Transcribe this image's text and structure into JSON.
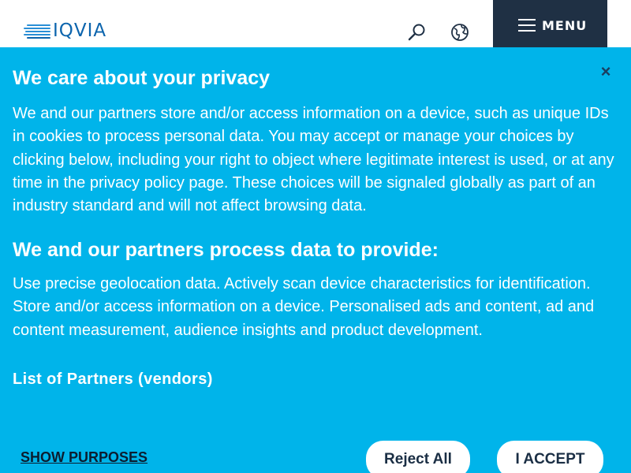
{
  "header": {
    "logo_text": "IQVIA",
    "menu_label": "MENU",
    "icons": {
      "search": "search-icon",
      "globe": "globe-icon",
      "menu": "hamburger-icon"
    }
  },
  "consent": {
    "title": "We care about your privacy",
    "body": "We and our partners store and/or access information on a device, such as unique IDs in cookies to process personal data. You may accept or manage your choices by clicking below, including your right to object where legitimate interest is used, or at any time in the privacy policy page. These choices will be signaled globally as part of an industry standard and will not affect browsing data.",
    "subtitle": "We and our partners process data to provide:",
    "purposes": "Use precise geolocation data. Actively scan device characteristics for identification. Store and/or access information on a device. Personalised ads and content, ad and content measurement, audience insights and product development.",
    "partners_link": "List of Partners (vendors)",
    "show_purposes": "SHOW PURPOSES",
    "reject_label": "Reject All",
    "accept_label": "I ACCEPT",
    "close_glyph": "×"
  },
  "colors": {
    "banner_bg": "#00b4ea",
    "menu_bg": "#1f3044",
    "logo": "#0b64ad"
  }
}
